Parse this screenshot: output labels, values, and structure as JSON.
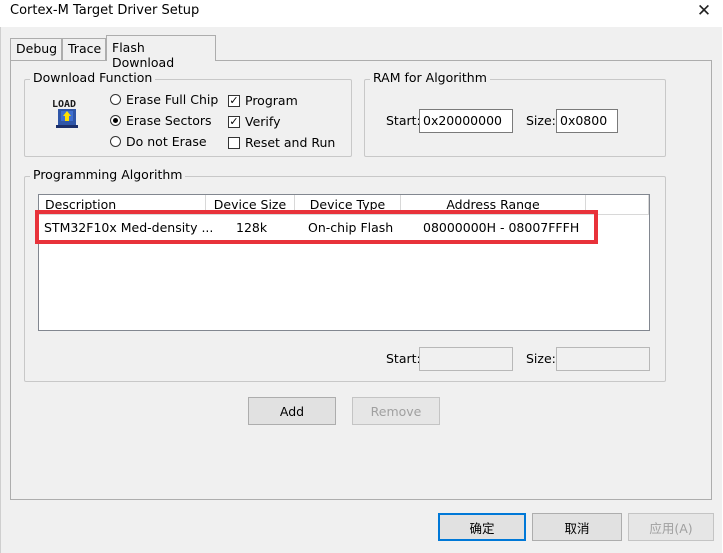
{
  "window": {
    "title": "Cortex-M Target Driver Setup",
    "close_glyph": "✕"
  },
  "tabs": [
    {
      "label": "Debug"
    },
    {
      "label": "Trace"
    },
    {
      "label": "Flash Download"
    }
  ],
  "download_function": {
    "legend": "Download Function",
    "icon": "load-icon",
    "icon_text": "LOAD",
    "erase_options": [
      {
        "label": "Erase Full Chip",
        "selected": false
      },
      {
        "label": "Erase Sectors",
        "selected": true
      },
      {
        "label": "Do not Erase",
        "selected": false
      }
    ],
    "checks": [
      {
        "label": "Program",
        "checked": true
      },
      {
        "label": "Verify",
        "checked": true
      },
      {
        "label": "Reset and Run",
        "checked": false
      }
    ]
  },
  "ram": {
    "legend": "RAM for Algorithm",
    "start_label": "Start:",
    "start_value": "0x20000000",
    "size_label": "Size:",
    "size_value": "0x0800"
  },
  "programming_algorithm": {
    "legend": "Programming Algorithm",
    "columns": [
      "Description",
      "Device Size",
      "Device Type",
      "Address Range"
    ],
    "rows": [
      {
        "description": "STM32F10x Med-density ...",
        "size": "128k",
        "type": "On-chip Flash",
        "range": "08000000H - 08007FFFH"
      }
    ],
    "start_label": "Start:",
    "size_label": "Size:",
    "start_value": "",
    "size_value": ""
  },
  "buttons": {
    "add": "Add",
    "remove": "Remove",
    "ok": "确定",
    "cancel": "取消",
    "apply": "应用(A)"
  },
  "colors": {
    "highlight": "#e8323a",
    "accent": "#0078d7"
  }
}
